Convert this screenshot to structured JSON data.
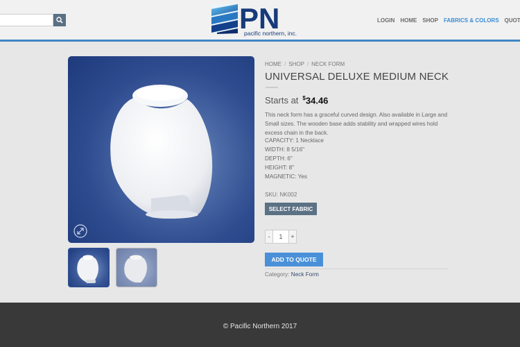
{
  "header": {
    "search_placeholder": "",
    "logo_letters": "PN",
    "logo_tagline": "pacific northern, inc.",
    "nav": [
      "LOGIN",
      "HOME",
      "SHOP",
      "FABRICS & COLORS",
      "QUOTE"
    ],
    "active_nav": "FABRICS & COLORS"
  },
  "breadcrumb": [
    "HOME",
    "SHOP",
    "NECK FORM"
  ],
  "product": {
    "title": "UNIVERSAL DELUXE MEDIUM NECK",
    "price_label": "Starts at",
    "price_symbol": "$",
    "price_amount": "34.46",
    "description": "This neck form has a graceful curved design. Also available in Large and Small sizes. The wooden base adds stability and wrapped wires hold excess chain in the back.",
    "specs": [
      "CAPACITY: 1 Necklace",
      "WIDTH: 8 5/16\"",
      "DEPTH: 6\"",
      "HEIGHT: 8\"",
      "MAGNETIC: Yes"
    ],
    "sku": "SKU: NK002",
    "select_fabric_label": "SELECT FABRIC",
    "qty_minus": "-",
    "qty_value": "1",
    "qty_plus": "+",
    "add_to_quote_label": "ADD TO QUOTE",
    "category_label": "Category:",
    "category_value": "Neck Form"
  },
  "footer": {
    "copyright": "© Pacific Northern 2017"
  },
  "colors": {
    "accent": "#3f86c7",
    "nav_active": "#3a8dd6",
    "button_dark": "#5b7184",
    "button_blue": "#4a90d9",
    "footer": "#393939"
  },
  "icons": [
    "search-icon",
    "zoom-icon"
  ]
}
